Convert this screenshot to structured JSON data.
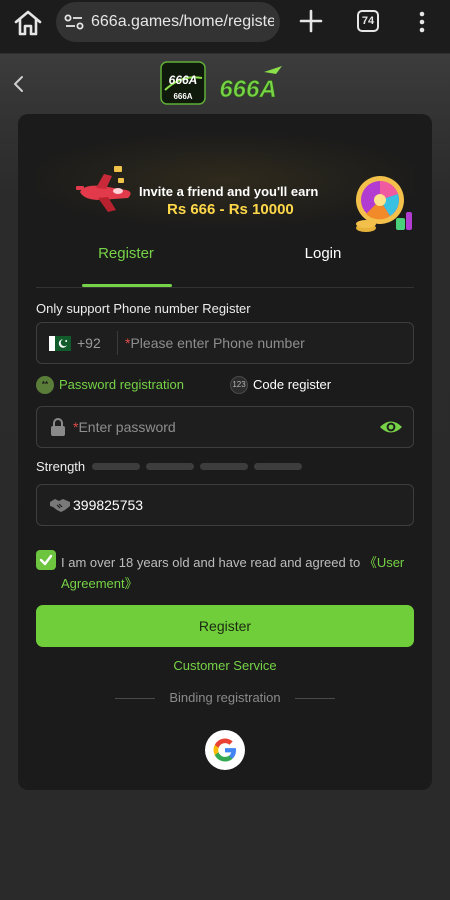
{
  "browser": {
    "url": "666a.games/home/registe",
    "tab_count": "74"
  },
  "header": {
    "logo_text": "666A",
    "logo_badge_text": "666A"
  },
  "banner": {
    "line1": "Invite a friend and you'll earn",
    "line2": "Rs 666 - Rs 10000"
  },
  "tabs": [
    {
      "label": "Register",
      "active": true
    },
    {
      "label": "Login",
      "active": false
    }
  ],
  "form": {
    "support_text": "Only support Phone number Register",
    "country_code": "+92",
    "phone_placeholder": "Please enter Phone number",
    "modes": {
      "password_label": "Password registration",
      "password_icon": "**",
      "code_label": "Code register",
      "code_icon": "123",
      "selected": "password"
    },
    "password_placeholder": "Enter password",
    "strength_label": "Strength",
    "invite_code": "399825753",
    "agreement_text": "I am over 18 years old and have read and agreed to ",
    "agreement_link": "《User Agreement》",
    "agreement_checked": true,
    "register_label": "Register",
    "customer_service": "Customer Service",
    "binding_label": "Binding registration"
  },
  "colors": {
    "accent": "#76d246",
    "button": "#6fce3a",
    "card": "#1b1b1b",
    "background": "#2a2a2a"
  },
  "icons": [
    "home-icon",
    "site-settings-icon",
    "new-tab-icon",
    "menu-icon",
    "back-icon",
    "pakistan-flag-icon",
    "lock-icon",
    "eye-icon",
    "handshake-icon",
    "checkbox-checked-icon",
    "google-icon"
  ]
}
